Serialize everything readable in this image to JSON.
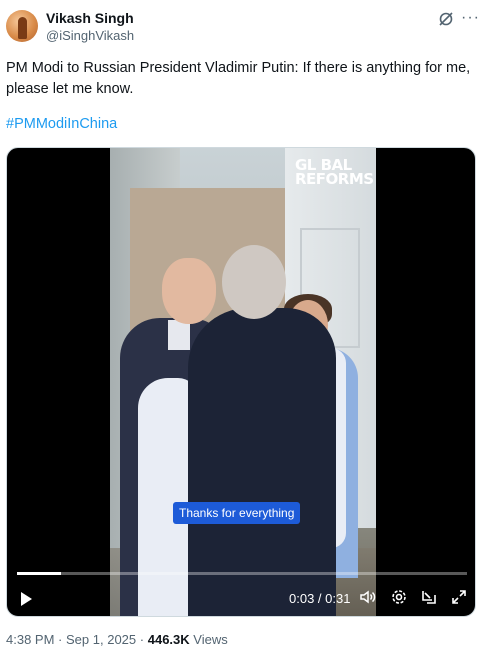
{
  "author": {
    "name": "Vikash Singh",
    "handle": "@iSinghVikash"
  },
  "post": {
    "text": "PM Modi to Russian President Vladimir Putin: If there is anything for me, please let me know.",
    "hashtag": "#PMModiInChina"
  },
  "video": {
    "watermark_line1": "GL BAL",
    "watermark_line2": "REFORMS",
    "caption": "Thanks for everything",
    "time_display": "0:03 / 0:31",
    "progress": 0.097,
    "play_icon": "play-icon",
    "volume_icon": "volume-icon",
    "settings_icon": "gear-icon",
    "pip_icon": "picture-in-picture-icon",
    "fullscreen_icon": "fullscreen-icon"
  },
  "meta": {
    "time": "4:38 PM",
    "sep": "·",
    "date": "Sep 1, 2025",
    "views_count": "446.3K",
    "views_label": "Views"
  },
  "colors": {
    "link": "#1d9bf0",
    "caption_bg": "#1d5bd8",
    "muted": "#536471"
  }
}
